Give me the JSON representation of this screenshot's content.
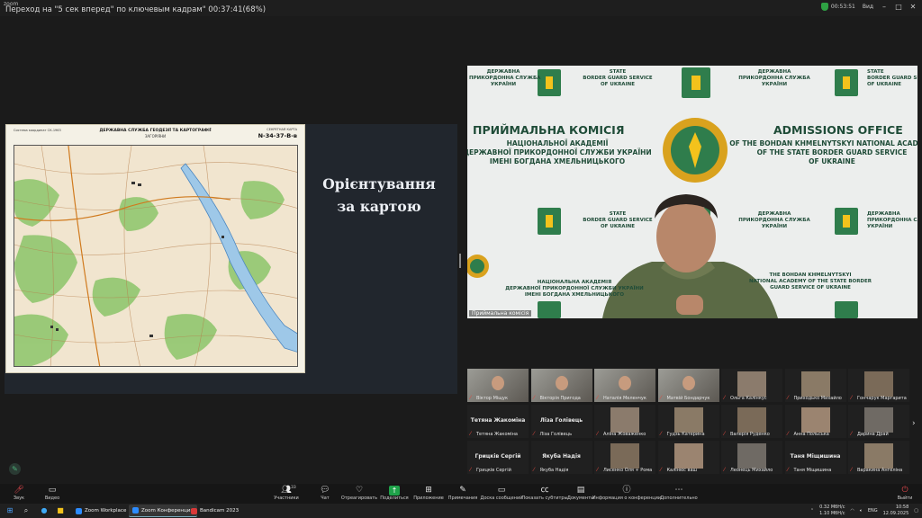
{
  "window": {
    "app_title": "zoom",
    "hint": "Переход на \"5 сек вперед\" по ключевым кадрам\" 00:37:41(68%)",
    "timer": "00:53:51",
    "view_label": "Вид",
    "controls": [
      "–",
      "□",
      "✕"
    ]
  },
  "slide": {
    "title_line1": "Орієнтування",
    "title_line2": "за картою",
    "map": {
      "org": "ДЕРЖАВНА СЛУЖБА ГЕОДЕЗІЇ ТА КАРТОГРАФІЇ",
      "name": "ЗАГОРІЯНИ",
      "sheet": "N-34-37-В-в",
      "left_small": "Система координат СК-1963",
      "right_small": "СЕКРЕТНАЯ КАРТА"
    }
  },
  "speaker": {
    "name": "Приймальна комісія",
    "texts": {
      "dps_ua": "ДЕРЖАВНА\nПРИКОРДОННА СЛУЖБА\nУКРАЇНИ",
      "sbgs_en": "STATE\nBORDER GUARD SERVICE\nOF UKRAINE",
      "committee_ua": "ПРИЙМАЛЬНА КОМІСІЯ",
      "academy_ua": "НАЦІОНАЛЬНОЇ АКАДЕМІЇ\nДЕРЖАВНОЇ ПРИКОРДОННОЇ СЛУЖБИ УКРАЇНИ\nІМЕНІ БОГДАНА ХМЕЛЬНИЦЬКОГО",
      "admissions_en": "ADMISSIONS OFFICE",
      "academy_en": "OF THE BOHDAN KHMELNYTSKYI NATIONAL ACADEMY\nOF THE STATE BORDER GUARD SERVICE\nOF UKRAINE",
      "academy_ua_small": "НАЦІОНАЛЬНА АКАДЕМІЯ\nДЕРЖАВНОЇ ПРИКОРДОННОЇ СЛУЖБИ УКРАЇНИ\nІМЕНІ БОГДАНА ХМЕЛЬНИЦЬКОГО",
      "academy_en_small": "THE BOHDAN KHMELNYTSKYI\nNATIONAL ACADEMY OF THE STATE BORDER\nGUARD SERVICE OF UKRAINE"
    }
  },
  "participants": [
    {
      "name": "Віктор Міщук",
      "video": true
    },
    {
      "name": "Вікторія Пригода",
      "video": true
    },
    {
      "name": "Наталія Меленчук",
      "video": true
    },
    {
      "name": "Матвій Бондарчук",
      "video": true
    },
    {
      "name": "Ольга Калінкус",
      "thumb": true
    },
    {
      "name": "Приходько Михайло",
      "thumb": true
    },
    {
      "name": "Гончарук Маргарита",
      "thumb": true
    },
    {
      "name": "Тетяна Жакоміна",
      "big": "Тетяна Жакоміна"
    },
    {
      "name": "Ліза Голівець",
      "big": "Ліза Голівець"
    },
    {
      "name": "Аліна Жоваженко",
      "thumb": true
    },
    {
      "name": "Гудзь Катерина",
      "thumb": true
    },
    {
      "name": "Валерія Руденко",
      "thumb": true
    },
    {
      "name": "Анна Польська",
      "thumb": true
    },
    {
      "name": "Дарина Драй",
      "thumb": true
    },
    {
      "name": "Грицків Сергій",
      "big": "Грицків Сергій"
    },
    {
      "name": "Якуба Надія",
      "big": "Якуба Надія"
    },
    {
      "name": "Лисенко Оля + Рома",
      "thumb": true
    },
    {
      "name": "Калінюс ваш",
      "thumb": true
    },
    {
      "name": "Леонець Михайло",
      "thumb": true
    },
    {
      "name": "Таня Міщишина",
      "big": "Таня Міщишина"
    },
    {
      "name": "Варакина Ангеліна",
      "thumb": true
    }
  ],
  "participant_count": "33",
  "toolbar": {
    "audio": "Звук",
    "video": "Видео",
    "participants": "Участники",
    "chat": "Чат",
    "react": "Отреагировать",
    "share": "Поделиться",
    "apps": "Приложение",
    "notes": "Примечания",
    "whiteboard": "Доска сообщений",
    "captions": "Показать субтитры",
    "docs": "Документы",
    "info": "Информация о конференции",
    "more": "Дополнительно",
    "leave": "Выйти"
  },
  "taskbar": {
    "apps": [
      {
        "label": "Zoom Workplace",
        "color": "#2d8cff",
        "active": false
      },
      {
        "label": "Zoom Конференция",
        "color": "#2d8cff",
        "active": true
      },
      {
        "label": "Bandicam 2023",
        "color": "#d93838",
        "active": false
      }
    ],
    "net_up": "0.32 МбН/с",
    "net_down": "1.10 МбН/с",
    "lang": "ENG",
    "time": "10:58",
    "date": "12.09.2025"
  }
}
